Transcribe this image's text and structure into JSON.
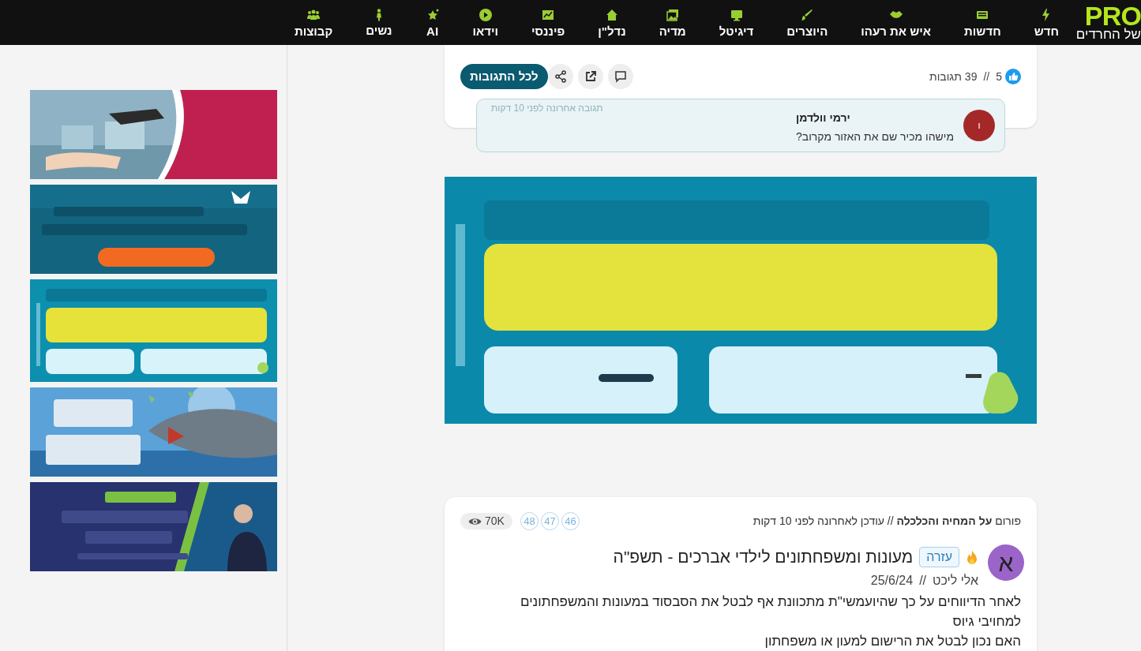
{
  "nav": {
    "logo": "PRO",
    "logo_subtitle": "של החרדים",
    "items": [
      {
        "label": "חדש"
      },
      {
        "label": "חדשות"
      },
      {
        "label": "איש את רעהו"
      },
      {
        "label": "היוצרים"
      },
      {
        "label": "דיגיטל"
      },
      {
        "label": "מדיה"
      },
      {
        "label": "נדל\"ן"
      },
      {
        "label": "פיננסי"
      },
      {
        "label": "וידאו"
      },
      {
        "label": "AI"
      },
      {
        "label": "נשים"
      },
      {
        "label": "קבוצות"
      }
    ]
  },
  "post_top": {
    "likes": "5",
    "separator": "//",
    "comments": "39 תגובות",
    "all_comments_button": "לכל התגובות",
    "last_reply": {
      "avatar": "ו",
      "author": "ירמי וולדמן",
      "text": "מישהו מכיר שם את האזור מקרוב?",
      "time": "תגובה אחרונה לפני 10 דקות"
    }
  },
  "post": {
    "forum_line": "פורום **על המחיה והכלכלה** // עודכן לאחרונה לפני 10 דקות",
    "pages": [
      "46",
      "47",
      "48"
    ],
    "views": "70K",
    "avatar": "א",
    "tag": "עזרה",
    "title": "מעונות ומשפחתונים לילדי אברכים - תשפ\"ה",
    "author": "אלי ליכט",
    "separator": "//",
    "date": "25/6/24",
    "body": [
      "לאחר הדיווחים על כך שהיועמשי\"ת מתכוונת אף לבטל את הסבסוד במעונות והמשפחתונים למחויבי גיוס",
      "האם נכון לבטל את הרישום למעון או משפחתון"
    ]
  }
}
